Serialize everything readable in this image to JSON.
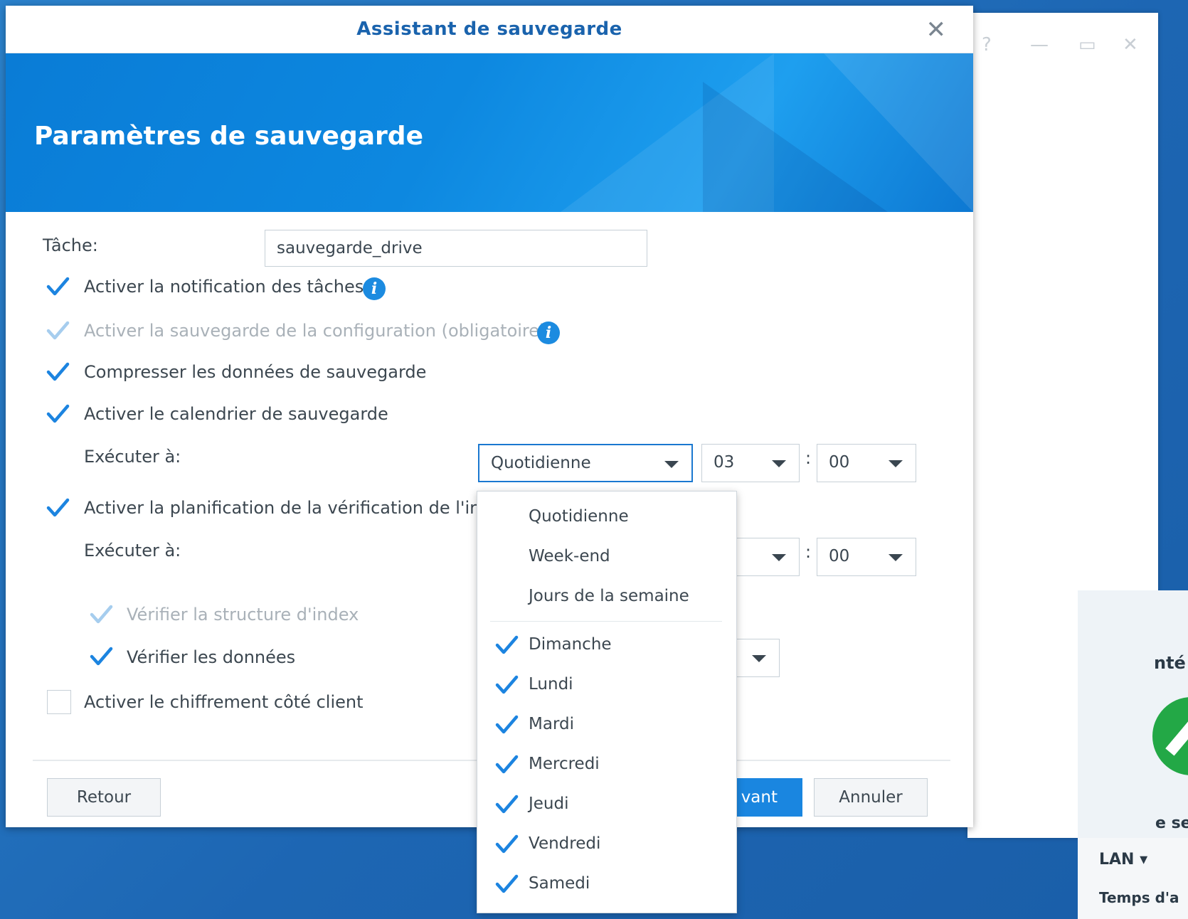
{
  "dialog": {
    "title": "Assistant de sauvegarde",
    "banner_title": "Paramètres de sauvegarde"
  },
  "task": {
    "label": "Tâche:",
    "value": "sauvegarde_drive"
  },
  "options": {
    "notification": {
      "label": "Activer la notification des tâches",
      "checked": true
    },
    "config_backup": {
      "label": "Activer la sauvegarde de la configuration (obligatoire)",
      "checked": true,
      "disabled": true
    },
    "compress": {
      "label": "Compresser les données de sauvegarde",
      "checked": true
    },
    "schedule": {
      "label": "Activer le calendrier de sauvegarde",
      "checked": true
    },
    "integrity": {
      "label": "Activer la planification de la vérification de l'ir",
      "checked": true
    },
    "verify_index": {
      "label": "Vérifier la structure d'index",
      "checked": true,
      "disabled": true
    },
    "verify_data": {
      "label": "Vérifier les données",
      "checked": true
    },
    "encryption": {
      "label": "Activer le chiffrement côté client",
      "checked": false
    }
  },
  "schedule": {
    "run_at_label": "Exécuter à:",
    "frequency": "Quotidienne",
    "hour": "03",
    "minute": "00",
    "colon": ":"
  },
  "integrity_schedule": {
    "run_at_label": "Exécuter à:",
    "minute": "00",
    "colon": ":"
  },
  "frequency_menu": {
    "options": [
      "Quotidienne",
      "Week-end",
      "Jours de la semaine"
    ],
    "days": [
      {
        "label": "Dimanche",
        "checked": true
      },
      {
        "label": "Lundi",
        "checked": true
      },
      {
        "label": "Mardi",
        "checked": true
      },
      {
        "label": "Mercredi",
        "checked": true
      },
      {
        "label": "Jeudi",
        "checked": true
      },
      {
        "label": "Vendredi",
        "checked": true
      },
      {
        "label": "Samedi",
        "checked": true
      }
    ]
  },
  "buttons": {
    "back": "Retour",
    "next_partial": "vant",
    "cancel": "Annuler"
  },
  "background": {
    "partial_text_1": "nté",
    "partial_text_2": "e se",
    "lan": "LAN ▾",
    "time_partial": "Temps d'a"
  },
  "colors": {
    "accent": "#1a86e0",
    "title": "#1a63ad",
    "check": "#1c84e0",
    "check_disabled": "#a6cdee"
  }
}
